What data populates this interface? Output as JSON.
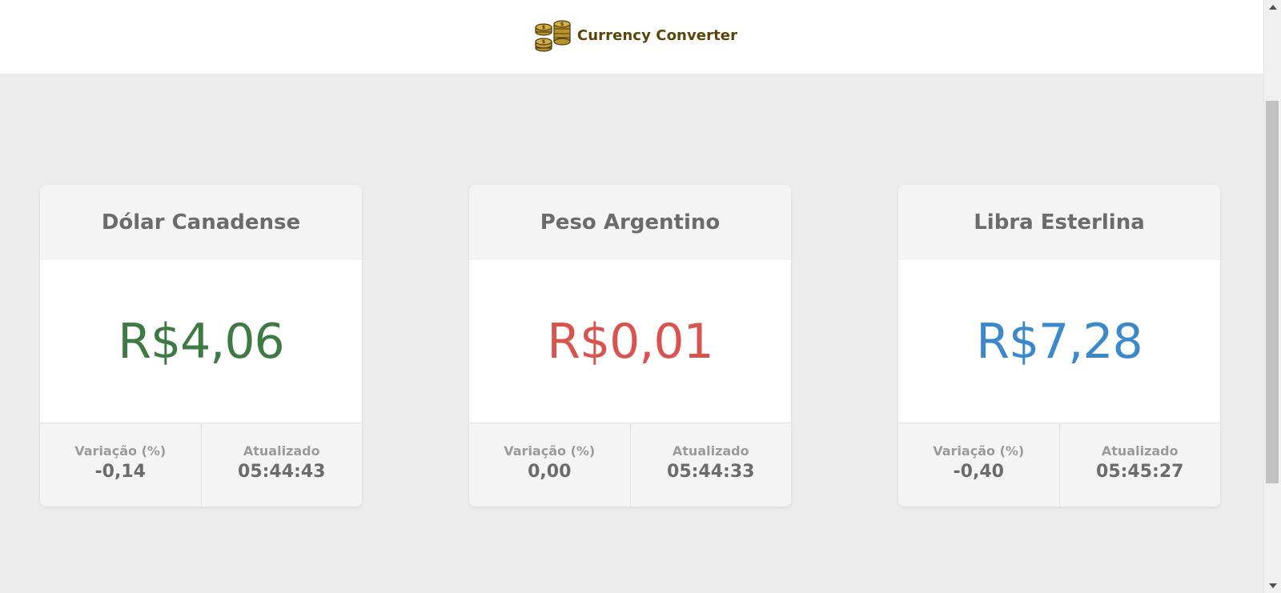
{
  "header": {
    "brand_icon": "coin-stack-icon",
    "brand_title": "Currency Converter",
    "brand_color": "#5a4408"
  },
  "cards": [
    {
      "title": "Dólar Canadense",
      "value": "R$4,06",
      "value_color": "#3d7a44",
      "variation_label": "Variação (%)",
      "variation_value": "-0,14",
      "updated_label": "Atualizado",
      "updated_value": "05:44:43"
    },
    {
      "title": "Peso Argentino",
      "value": "R$0,01",
      "value_color": "#d9534f",
      "variation_label": "Variação (%)",
      "variation_value": "0,00",
      "updated_label": "Atualizado",
      "updated_value": "05:44:33"
    },
    {
      "title": "Libra Esterlina",
      "value": "R$7,28",
      "value_color": "#3c88cc",
      "variation_label": "Variação (%)",
      "variation_value": "-0,40",
      "updated_label": "Atualizado",
      "updated_value": "05:45:27"
    }
  ],
  "scrollbar": {
    "up_icon": "scroll-up-arrow-icon",
    "down_icon": "scroll-down-arrow-icon"
  }
}
